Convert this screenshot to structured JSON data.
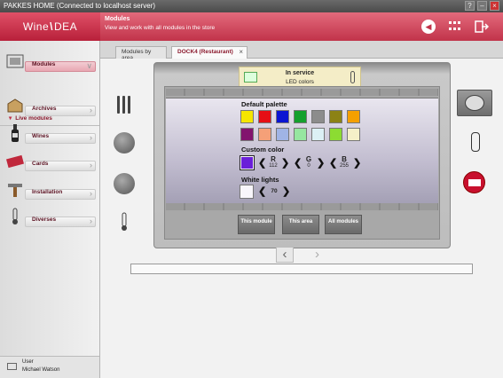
{
  "window": {
    "title": "PAKKES HOME (Connected to localhost server)"
  },
  "header": {
    "brand_left": "Wine",
    "brand_right": "DEA",
    "title": "Modules",
    "subtitle": "View and work with all modules in the store"
  },
  "sidebar": {
    "items": [
      {
        "label": "Modules",
        "icon": "modules-icon",
        "active": true
      },
      {
        "label": "Archives",
        "icon": "archives-icon"
      },
      {
        "label": "Wines",
        "icon": "wine-bottle-icon"
      },
      {
        "label": "Cards",
        "icon": "cards-icon"
      },
      {
        "label": "Installation",
        "icon": "installation-icon"
      },
      {
        "label": "Diverses",
        "icon": "thermometer-icon"
      }
    ],
    "sub_item": "Live modules",
    "user_label": "User",
    "user_name": "Michael Watson"
  },
  "tabs": [
    {
      "label": "Modules by area"
    },
    {
      "label": "DOCK4 (Restaurant)",
      "active": true
    }
  ],
  "status": {
    "line1": "In service",
    "line2": "LED colors"
  },
  "palette": {
    "default_label": "Default palette",
    "colors_row1": [
      "#f5e600",
      "#e60f14",
      "#0a14d2",
      "#14a02d",
      "#8c8c8c",
      "#8c8214",
      "#f5a000"
    ],
    "colors_row2": [
      "#82146e",
      "#f5a078",
      "#a0b4e6",
      "#96e6a0",
      "#dcf0f5",
      "#8cdc32",
      "#f5f0c8"
    ],
    "custom_label": "Custom color",
    "custom_color": "#6a1fd8",
    "r_label": "R",
    "r_value": "112",
    "g_label": "G",
    "g_value": "0",
    "b_label": "B",
    "b_value": "255",
    "white_label": "White lights",
    "white_value": "70"
  },
  "actions": {
    "this_module": "This module",
    "this_area": "This area",
    "all_modules": "All modules"
  },
  "colors": {
    "accent": "#c1334a",
    "brand": "#b8203a"
  }
}
